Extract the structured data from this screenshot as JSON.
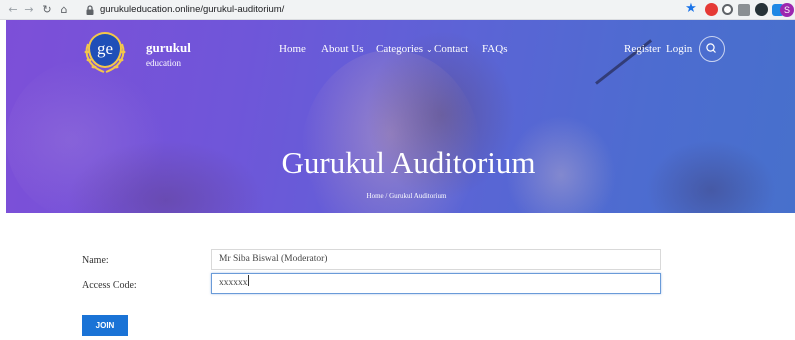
{
  "browser": {
    "url": "gurukuleducation.online/gurukul-auditorium/",
    "profile_initial": "S"
  },
  "site": {
    "brand": "gurukul",
    "brand_sub": "education",
    "logo_text": "ge",
    "menu": {
      "home": "Home",
      "about": "About Us",
      "categories": "Categories",
      "contact": "Contact",
      "faqs": "FAQs",
      "register": "Register",
      "login": "Login"
    }
  },
  "hero": {
    "title": "Gurukul Auditorium",
    "breadcrumb": "Home / Gurukul Auditorium"
  },
  "form": {
    "name_label": "Name:",
    "name_value": "Mr Siba Biswal (Moderator)",
    "code_label": "Access Code:",
    "code_value": "xxxxxx",
    "join_label": "JOIN"
  },
  "colors": {
    "join_button": "#1a73d6",
    "hero_gradient_start": "#7d4fd8",
    "hero_gradient_end": "#4770cc"
  }
}
